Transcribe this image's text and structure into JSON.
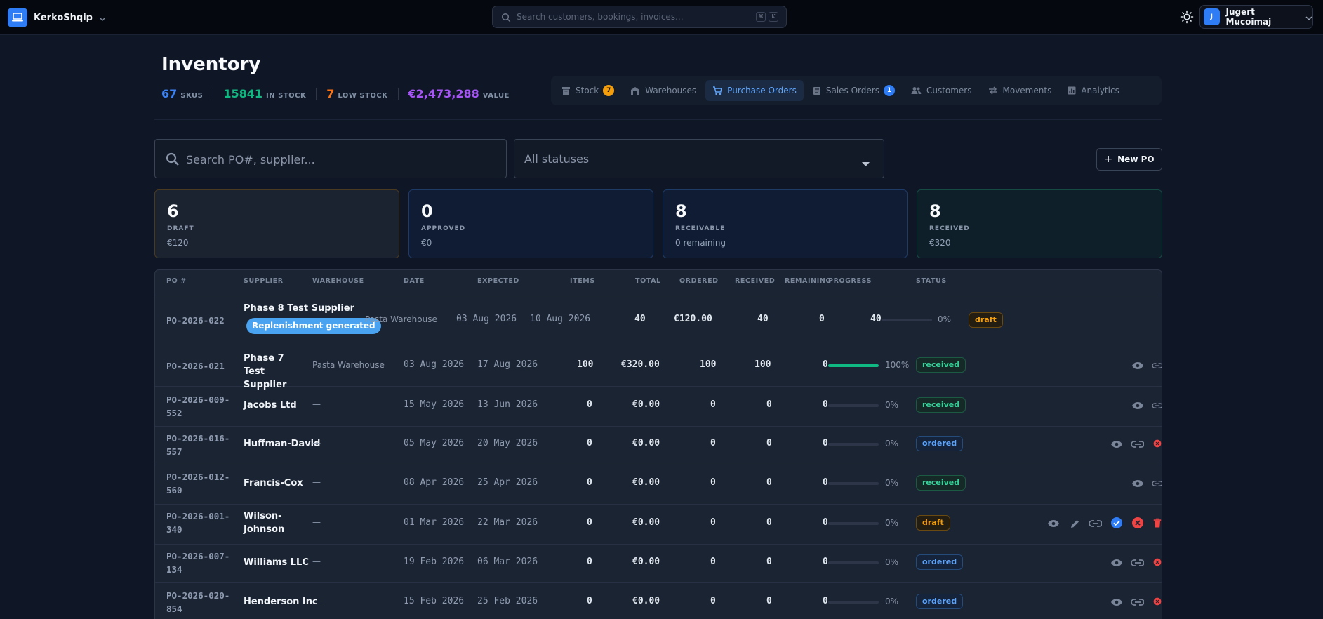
{
  "app": {
    "name": "KerkoShqip"
  },
  "search": {
    "placeholder": "Search customers, bookings, invoices...",
    "kbd1": "⌘",
    "kbd2": "K"
  },
  "user": {
    "initial": "J",
    "name": "Jugert Mucoimaj"
  },
  "page": {
    "title": "Inventory"
  },
  "stats": [
    {
      "value": "67",
      "label": "SKUS",
      "color": "#3b82f6"
    },
    {
      "value": "15841",
      "label": "IN STOCK",
      "color": "#10b981"
    },
    {
      "value": "7",
      "label": "LOW STOCK",
      "color": "#f97316"
    },
    {
      "value": "€2,473,288",
      "label": "VALUE",
      "color": "#a855f7"
    }
  ],
  "tabs": [
    {
      "label": "Stock",
      "icon": "box-icon",
      "badge": "7",
      "badge_color": "#f59e0b"
    },
    {
      "label": "Warehouses",
      "icon": "warehouse-icon"
    },
    {
      "label": "Purchase Orders",
      "icon": "cart-icon",
      "active": true
    },
    {
      "label": "Sales Orders",
      "icon": "receipt-icon",
      "badge": "1",
      "badge_color": "#2f7df6"
    },
    {
      "label": "Customers",
      "icon": "people-icon"
    },
    {
      "label": "Movements",
      "icon": "swap-icon"
    },
    {
      "label": "Analytics",
      "icon": "chart-icon"
    }
  ],
  "toolbar": {
    "search_placeholder": "Search PO#, supplier...",
    "status_value": "All statuses",
    "new_po_label": "New PO"
  },
  "cards": [
    {
      "value": "6",
      "label": "DRAFT",
      "sub": "€120",
      "bg": "#1b2230",
      "border": "#4a3a22"
    },
    {
      "value": "0",
      "label": "APPROVED",
      "sub": "€0",
      "bg": "#0f1c33",
      "border": "#1e3a66"
    },
    {
      "value": "8",
      "label": "RECEIVABLE",
      "sub": "0 remaining",
      "bg": "#0f1c33",
      "border": "#1e3a66"
    },
    {
      "value": "8",
      "label": "RECEIVED",
      "sub": "€320",
      "bg": "#0e1f2a",
      "border": "#164a44"
    }
  ],
  "table": {
    "headers": [
      "PO #",
      "SUPPLIER",
      "WAREHOUSE",
      "DATE",
      "EXPECTED",
      "ITEMS",
      "TOTAL",
      "ORDERED",
      "RECEIVED",
      "REMAINING",
      "PROGRESS",
      "STATUS"
    ],
    "rows": [
      {
        "po": "PO-2026-022",
        "supplier": "Phase 8 Test Supplier",
        "chip": "Replenishment generated",
        "warehouse": "Pasta Warehouse",
        "date": "03 Aug 2026",
        "expected": "10 Aug 2026",
        "items": "40",
        "total": "€120.00",
        "ordered": "40",
        "received": "0",
        "remaining": "40",
        "progress": 0,
        "pct": "0%",
        "status": "draft"
      },
      {
        "po": "PO-2026-021",
        "supplier": "Phase 7 Test Supplier",
        "warehouse": "Pasta Warehouse",
        "date": "03 Aug 2026",
        "expected": "17 Aug 2026",
        "items": "100",
        "total": "€320.00",
        "ordered": "100",
        "received": "100",
        "remaining": "0",
        "progress": 1,
        "pct": "100%",
        "status": "received"
      },
      {
        "po": "PO-2026-009-552",
        "supplier": "Jacobs Ltd",
        "warehouse": "—",
        "date": "15 May 2026",
        "expected": "13 Jun 2026",
        "items": "0",
        "total": "€0.00",
        "ordered": "0",
        "received": "0",
        "remaining": "0",
        "progress": 0,
        "pct": "0%",
        "status": "received"
      },
      {
        "po": "PO-2026-016-557",
        "supplier": "Huffman-David",
        "warehouse": "—",
        "date": "05 May 2026",
        "expected": "20 May 2026",
        "items": "0",
        "total": "€0.00",
        "ordered": "0",
        "received": "0",
        "remaining": "0",
        "progress": 0,
        "pct": "0%",
        "status": "ordered"
      },
      {
        "po": "PO-2026-012-560",
        "supplier": "Francis-Cox",
        "warehouse": "—",
        "date": "08 Apr 2026",
        "expected": "25 Apr 2026",
        "items": "0",
        "total": "€0.00",
        "ordered": "0",
        "received": "0",
        "remaining": "0",
        "progress": 0,
        "pct": "0%",
        "status": "received"
      },
      {
        "po": "PO-2026-001-340",
        "supplier": "Wilson-Johnson",
        "warehouse": "—",
        "date": "01 Mar 2026",
        "expected": "22 Mar 2026",
        "items": "0",
        "total": "€0.00",
        "ordered": "0",
        "received": "0",
        "remaining": "0",
        "progress": 0,
        "pct": "0%",
        "status": "draft"
      },
      {
        "po": "PO-2026-007-134",
        "supplier": "Williams LLC",
        "warehouse": "—",
        "date": "19 Feb 2026",
        "expected": "06 Mar 2026",
        "items": "0",
        "total": "€0.00",
        "ordered": "0",
        "received": "0",
        "remaining": "0",
        "progress": 0,
        "pct": "0%",
        "status": "ordered"
      },
      {
        "po": "PO-2026-020-854",
        "supplier": "Henderson Inc",
        "warehouse": "—",
        "date": "15 Feb 2026",
        "expected": "25 Feb 2026",
        "items": "0",
        "total": "€0.00",
        "ordered": "0",
        "received": "0",
        "remaining": "0",
        "progress": 0,
        "pct": "0%",
        "status": "ordered"
      }
    ]
  }
}
